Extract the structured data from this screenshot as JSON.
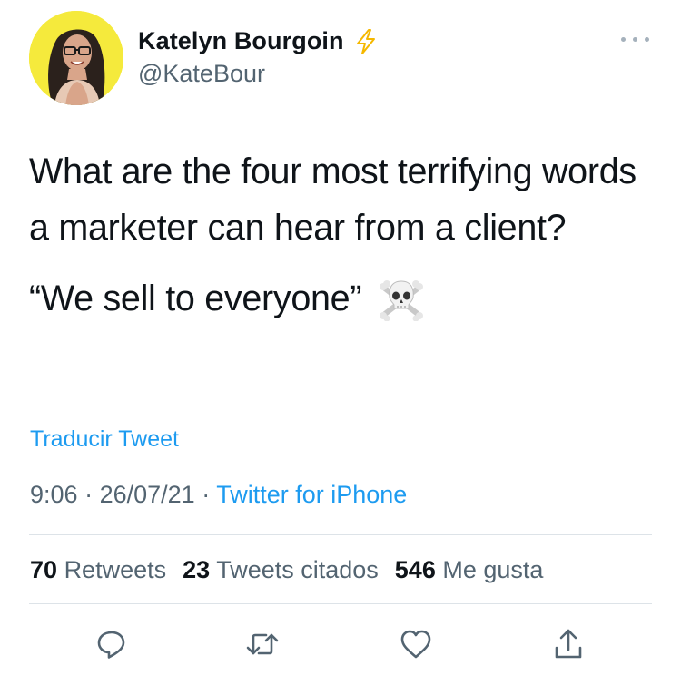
{
  "author": {
    "display_name": "Katelyn Bourgoin",
    "handle": "@KateBour",
    "badge_icon": "lightning-bolt-icon",
    "avatar_bg": "#f5ea3c"
  },
  "tweet": {
    "paragraph1": "What are the four most terrifying words a marketer can hear from a client?",
    "paragraph2": "“We sell to everyone”",
    "emoji_icon": "skull-crossbones-icon"
  },
  "translate_label": "Traducir Tweet",
  "meta": {
    "time": "9:06",
    "separator": "·",
    "date": "26/07/21",
    "source": "Twitter for iPhone"
  },
  "stats": {
    "retweets_count": "70",
    "retweets_label": "Retweets",
    "quotes_count": "23",
    "quotes_label": "Tweets citados",
    "likes_count": "546",
    "likes_label": "Me gusta"
  },
  "actions": [
    {
      "icon": "reply-icon"
    },
    {
      "icon": "retweet-icon"
    },
    {
      "icon": "like-icon"
    },
    {
      "icon": "share-icon"
    }
  ],
  "colors": {
    "accent": "#1d9bf0",
    "secondary_text": "#536471",
    "primary_text": "#0f1419",
    "bolt": "#f5b800"
  }
}
